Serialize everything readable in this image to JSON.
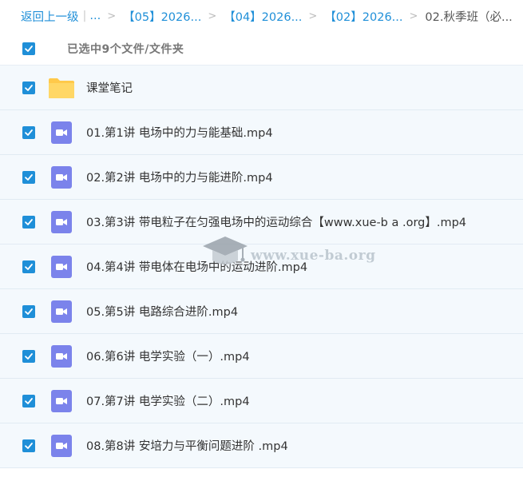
{
  "breadcrumb": {
    "back": "返回上一级",
    "ellipsis": "...",
    "crumbs": [
      "【05】2026...",
      "【04】2026...",
      "【02】2026..."
    ],
    "current": "02.秋季班（必..."
  },
  "selection": {
    "text": "已选中9个文件/文件夹",
    "checked": true
  },
  "files": [
    {
      "name": "课堂笔记",
      "type": "folder",
      "checked": true
    },
    {
      "name": "01.第1讲 电场中的力与能基础.mp4",
      "type": "video",
      "checked": true
    },
    {
      "name": "02.第2讲 电场中的力与能进阶.mp4",
      "type": "video",
      "checked": true
    },
    {
      "name": "03.第3讲 带电粒子在匀强电场中的运动综合【www.xue-b a .org】.mp4",
      "type": "video",
      "checked": true
    },
    {
      "name": "04.第4讲 带电体在电场中的运动进阶.mp4",
      "type": "video",
      "checked": true
    },
    {
      "name": "05.第5讲 电路综合进阶.mp4",
      "type": "video",
      "checked": true
    },
    {
      "name": "06.第6讲 电学实验（一）.mp4",
      "type": "video",
      "checked": true
    },
    {
      "name": "07.第7讲 电学实验（二）.mp4",
      "type": "video",
      "checked": true
    },
    {
      "name": "08.第8讲 安培力与平衡问题进阶 .mp4",
      "type": "video",
      "checked": true
    }
  ],
  "watermark": {
    "text": "www.xue-ba.org"
  },
  "colors": {
    "accent": "#1f8fd8",
    "video_icon": "#7b83eb",
    "folder": "#ffd15c",
    "row_bg": "#f4f9fd"
  }
}
